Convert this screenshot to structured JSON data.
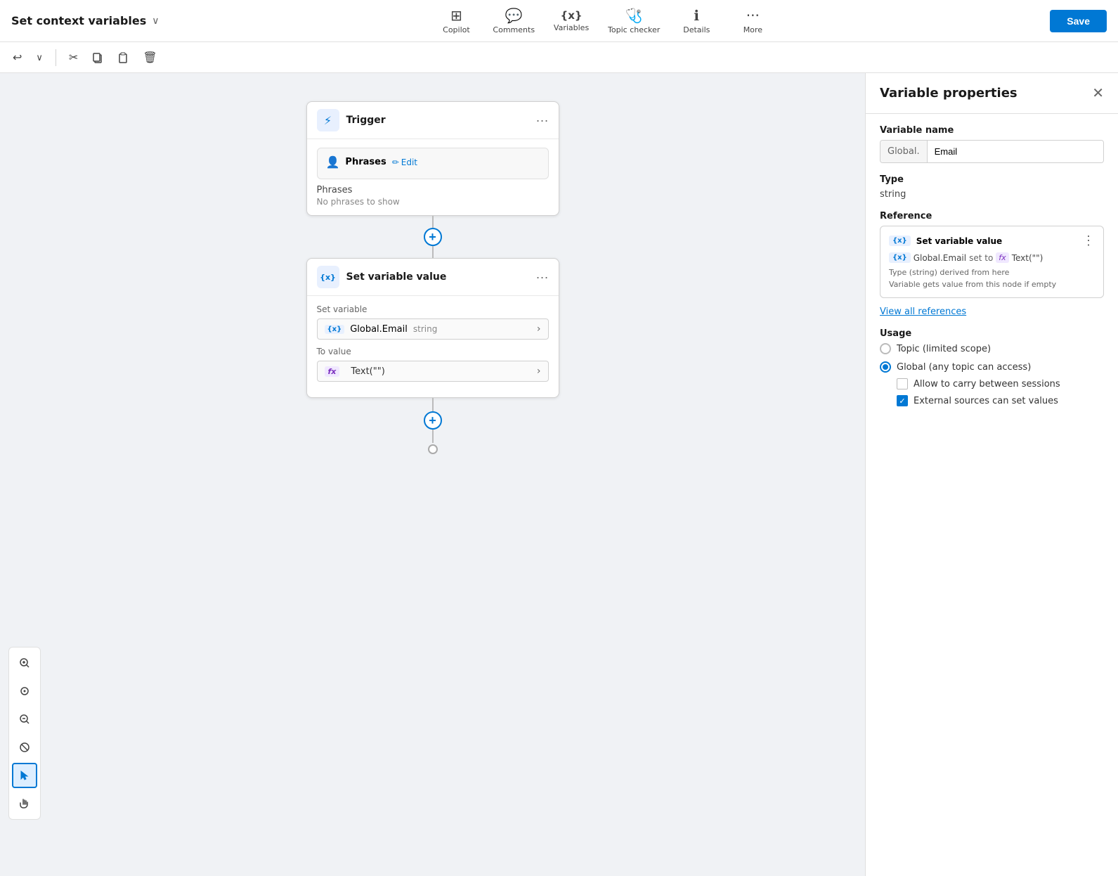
{
  "topbar": {
    "title": "Set context variables",
    "nav": [
      {
        "id": "copilot",
        "label": "Copilot",
        "icon": "⊞"
      },
      {
        "id": "comments",
        "label": "Comments",
        "icon": "💬"
      },
      {
        "id": "variables",
        "label": "Variables",
        "icon": "{x}"
      },
      {
        "id": "topic_checker",
        "label": "Topic checker",
        "icon": "🩺"
      },
      {
        "id": "details",
        "label": "Details",
        "icon": "ℹ"
      },
      {
        "id": "more",
        "label": "More",
        "icon": "···"
      }
    ],
    "save_label": "Save"
  },
  "toolbar": {
    "undo_label": "↩",
    "redo_label": "↪",
    "cut_label": "✂",
    "copy_label": "⧉",
    "paste_label": "📋",
    "delete_label": "🗑"
  },
  "canvas": {
    "trigger_node": {
      "title": "Trigger",
      "phrases_title": "Phrases",
      "phrases_edit": "Edit",
      "phrases_label": "Phrases",
      "phrases_empty": "No phrases to show"
    },
    "variable_node": {
      "title": "Set variable value",
      "set_variable_label": "Set variable",
      "variable_badge": "{x}",
      "variable_name": "Global.Email",
      "variable_type": "string",
      "to_value_label": "To value",
      "fx_value": "Text(\"\")"
    }
  },
  "right_panel": {
    "title": "Variable properties",
    "var_name_label": "Variable name",
    "var_prefix": "Global.",
    "var_name_value": "Email",
    "type_label": "Type",
    "type_value": "string",
    "reference_label": "Reference",
    "ref_title": "Set variable value",
    "ref_badge": "{x}",
    "ref_var": "Global.Email",
    "ref_set_to": "set to",
    "ref_fx_label": "fx",
    "ref_fx_value": "Text(\"\")",
    "ref_meta_line1": "Type (string) derived from here",
    "ref_meta_line2": "Variable gets value from this node if empty",
    "view_refs_label": "View all references",
    "usage_label": "Usage",
    "usage_option1": "Topic (limited scope)",
    "usage_option2": "Global (any topic can access)",
    "checkbox1_label": "Allow to carry between sessions",
    "checkbox2_label": "External sources can set values"
  },
  "left_toolbar": {
    "zoom_in": "+",
    "center": "◎",
    "zoom_out": "−",
    "no_fit": "⊘",
    "pointer": "↖",
    "hand": "✋"
  }
}
